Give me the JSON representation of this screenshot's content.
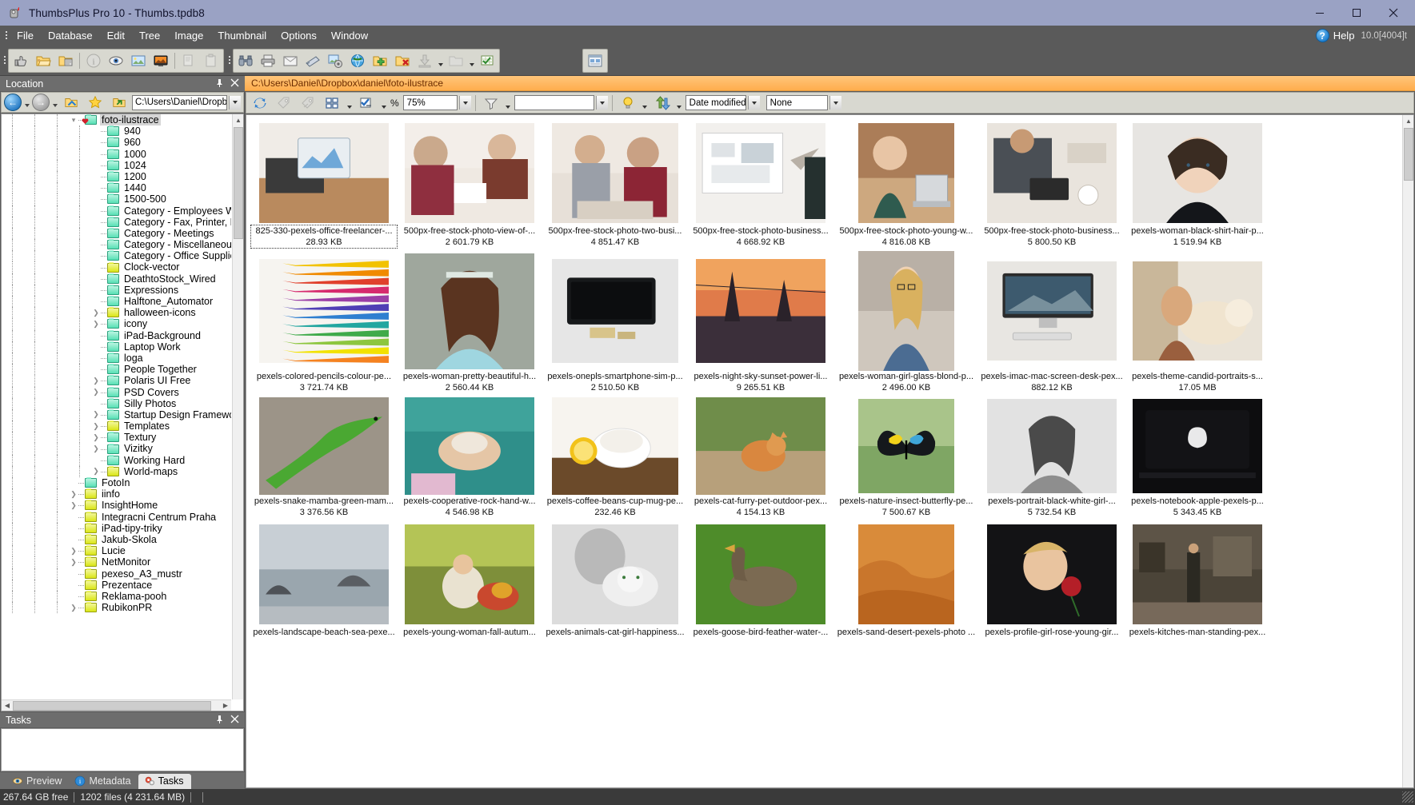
{
  "window": {
    "title": "ThumbsPlus Pro 10 - Thumbs.tpdb8",
    "app_icon": "thumbsplus-icon",
    "minimize": "–",
    "maximize": "□",
    "close": "✕"
  },
  "menubar": {
    "items": [
      "File",
      "Database",
      "Edit",
      "Tree",
      "Image",
      "Thumbnail",
      "Options",
      "Window"
    ],
    "help_label": "Help",
    "help_glyph": "?",
    "version": "10.0[4004]t"
  },
  "toolbar": {
    "group1": [
      "thumb-up-icon",
      "folder-open-icon",
      "folder-scan-icon",
      "info-icon",
      "eye-icon",
      "gallery-icon",
      "slideshow-icon",
      "copy-icon",
      "paste-icon"
    ],
    "group2": [
      "binoculars-icon",
      "print-icon",
      "email-icon",
      "scanner-icon",
      "batch-icon",
      "globe-icon",
      "folder-add-icon",
      "folder-delete-icon",
      "download-icon",
      "grid-check-icon"
    ],
    "group3": [
      "gallery-window-icon"
    ]
  },
  "location_panel": {
    "title": "Location",
    "pin": "📌",
    "close": "✕",
    "path_value": "C:\\Users\\Daniel\\Dropbox\\c",
    "nav_back": "back-arrow-icon",
    "nav_forward": "forward-arrow-icon",
    "buttons": [
      "folder-up-icon",
      "favorites-star-icon",
      "folder-go-icon"
    ]
  },
  "tree": {
    "items": [
      {
        "label": "foto-ilustrace",
        "depth": 4,
        "icon": "folder-teal-open",
        "twisty": "expanded",
        "selected": true,
        "favorite": true
      },
      {
        "label": "940",
        "depth": 5,
        "icon": "folder-teal",
        "twisty": "none"
      },
      {
        "label": "960",
        "depth": 5,
        "icon": "folder-teal",
        "twisty": "none"
      },
      {
        "label": "1000",
        "depth": 5,
        "icon": "folder-teal",
        "twisty": "none"
      },
      {
        "label": "1024",
        "depth": 5,
        "icon": "folder-teal",
        "twisty": "none"
      },
      {
        "label": "1200",
        "depth": 5,
        "icon": "folder-teal",
        "twisty": "none"
      },
      {
        "label": "1440",
        "depth": 5,
        "icon": "folder-teal",
        "twisty": "none"
      },
      {
        "label": "1500-500",
        "depth": 5,
        "icon": "folder-teal",
        "twisty": "none"
      },
      {
        "label": "Category - Employees Worki",
        "depth": 5,
        "icon": "folder-teal",
        "twisty": "none"
      },
      {
        "label": "Category - Fax, Printer, Phon",
        "depth": 5,
        "icon": "folder-teal",
        "twisty": "none"
      },
      {
        "label": "Category - Meetings",
        "depth": 5,
        "icon": "folder-teal",
        "twisty": "none"
      },
      {
        "label": "Category - Miscellaneous",
        "depth": 5,
        "icon": "folder-teal",
        "twisty": "none"
      },
      {
        "label": "Category - Office Supplies",
        "depth": 5,
        "icon": "folder-teal",
        "twisty": "none"
      },
      {
        "label": "Clock-vector",
        "depth": 5,
        "icon": "folder-yellow",
        "twisty": "none"
      },
      {
        "label": "DeathtoStock_Wired",
        "depth": 5,
        "icon": "folder-teal",
        "twisty": "none"
      },
      {
        "label": "Expressions",
        "depth": 5,
        "icon": "folder-teal",
        "twisty": "none"
      },
      {
        "label": "Halftone_Automator",
        "depth": 5,
        "icon": "folder-teal",
        "twisty": "none"
      },
      {
        "label": "halloween-icons",
        "depth": 5,
        "icon": "folder-yellow",
        "twisty": "collapsed"
      },
      {
        "label": "icony",
        "depth": 5,
        "icon": "folder-teal",
        "twisty": "collapsed"
      },
      {
        "label": "iPad-Background",
        "depth": 5,
        "icon": "folder-teal",
        "twisty": "none"
      },
      {
        "label": "Laptop Work",
        "depth": 5,
        "icon": "folder-teal",
        "twisty": "none"
      },
      {
        "label": "loga",
        "depth": 5,
        "icon": "folder-teal",
        "twisty": "none"
      },
      {
        "label": "People Together",
        "depth": 5,
        "icon": "folder-teal",
        "twisty": "none"
      },
      {
        "label": "Polaris UI Free",
        "depth": 5,
        "icon": "folder-teal",
        "twisty": "collapsed"
      },
      {
        "label": "PSD Covers",
        "depth": 5,
        "icon": "folder-teal",
        "twisty": "collapsed"
      },
      {
        "label": "Silly Photos",
        "depth": 5,
        "icon": "folder-teal",
        "twisty": "none"
      },
      {
        "label": "Startup Design Framework",
        "depth": 5,
        "icon": "folder-teal",
        "twisty": "collapsed"
      },
      {
        "label": "Templates",
        "depth": 5,
        "icon": "folder-yellow",
        "twisty": "collapsed"
      },
      {
        "label": "Textury",
        "depth": 5,
        "icon": "folder-teal",
        "twisty": "collapsed"
      },
      {
        "label": "Vizitky",
        "depth": 5,
        "icon": "folder-teal",
        "twisty": "collapsed"
      },
      {
        "label": "Working Hard",
        "depth": 5,
        "icon": "folder-teal",
        "twisty": "none"
      },
      {
        "label": "World-maps",
        "depth": 5,
        "icon": "folder-yellow",
        "twisty": "collapsed"
      },
      {
        "label": "FotoIn",
        "depth": 4,
        "icon": "folder-teal",
        "twisty": "none"
      },
      {
        "label": "iinfo",
        "depth": 4,
        "icon": "folder-yellow",
        "twisty": "collapsed"
      },
      {
        "label": "InsightHome",
        "depth": 4,
        "icon": "folder-yellow",
        "twisty": "collapsed"
      },
      {
        "label": "Integracni Centrum Praha",
        "depth": 4,
        "icon": "folder-yellow",
        "twisty": "none"
      },
      {
        "label": "iPad-tipy-triky",
        "depth": 4,
        "icon": "folder-yellow",
        "twisty": "none"
      },
      {
        "label": "Jakub-Skola",
        "depth": 4,
        "icon": "folder-yellow",
        "twisty": "none"
      },
      {
        "label": "Lucie",
        "depth": 4,
        "icon": "folder-yellow",
        "twisty": "collapsed"
      },
      {
        "label": "NetMonitor",
        "depth": 4,
        "icon": "folder-yellow",
        "twisty": "collapsed"
      },
      {
        "label": "pexeso_A3_mustr",
        "depth": 4,
        "icon": "folder-yellow",
        "twisty": "none"
      },
      {
        "label": "Prezentace",
        "depth": 4,
        "icon": "folder-yellow",
        "twisty": "none"
      },
      {
        "label": "Reklama-pooh",
        "depth": 4,
        "icon": "folder-yellow",
        "twisty": "none"
      },
      {
        "label": "RubikonPR",
        "depth": 4,
        "icon": "folder-yellow",
        "twisty": "collapsed"
      }
    ]
  },
  "tasks_panel": {
    "title": "Tasks",
    "pin": "📌",
    "close": "✕",
    "tabs": [
      {
        "label": "Preview",
        "icon": "eye-icon",
        "active": false
      },
      {
        "label": "Metadata",
        "icon": "info-icon",
        "active": false
      },
      {
        "label": "Tasks",
        "icon": "gears-icon",
        "active": true
      }
    ]
  },
  "view": {
    "path_bar": "C:\\Users\\Daniel\\Dropbox\\daniel\\foto-ilustrace",
    "refresh_icon": "refresh-icon",
    "tag_icon": "tag-icon",
    "tag_off_icon": "tag-off-icon",
    "layout_icon": "layout-icon",
    "select_icon": "select-check-icon",
    "percent_label": "%",
    "zoom_value": "75%",
    "filter_icon": "filter-icon",
    "filter_value": "",
    "bulb_icon": "lightbulb-icon",
    "sort_dir_icon": "sort-arrows-icon",
    "sort_field": "Date modified",
    "group_field": "None"
  },
  "thumbnails": {
    "rows": [
      [
        {
          "file": "825-330-pexels-office-freelancer-...",
          "size": "28.93 KB",
          "alt": "tablet-on-desk-with-laptop",
          "selected": true
        },
        {
          "file": "500px-free-stock-photo-view-of-...",
          "size": "2 601.79 KB",
          "alt": "people-at-table-planning"
        },
        {
          "file": "500px-free-stock-photo-two-busi...",
          "size": "4 851.47 KB",
          "alt": "two-business-people-meeting"
        },
        {
          "file": "500px-free-stock-photo-business...",
          "size": "4 668.92 KB",
          "alt": "business-presentation-whiteboard"
        },
        {
          "file": "500px-free-stock-photo-young-w...",
          "size": "4 816.08 KB",
          "alt": "young-woman-at-laptop"
        },
        {
          "file": "500px-free-stock-photo-business...",
          "size": "5 800.50 KB",
          "alt": "man-with-tablet-at-desk"
        },
        {
          "file": "pexels-woman-black-shirt-hair-p...",
          "size": "1 519.94 KB",
          "alt": "woman-portrait-black-shirt"
        }
      ],
      [
        {
          "file": "pexels-colored-pencils-colour-pe...",
          "size": "3 721.74 KB",
          "alt": "colored-pencils"
        },
        {
          "file": "pexels-woman-pretty-beautiful-h...",
          "size": "2 560.44 KB",
          "alt": "smiling-woman-portrait"
        },
        {
          "file": "pexels-onepls-smartphone-sim-p...",
          "size": "2 510.50 KB",
          "alt": "black-smartphone-on-table"
        },
        {
          "file": "pexels-night-sky-sunset-power-li...",
          "size": "9 265.51 KB",
          "alt": "power-lines-at-sunset"
        },
        {
          "file": "pexels-woman-girl-glass-blond-p...",
          "size": "2 496.00 KB",
          "alt": "blond-woman-with-glasses"
        },
        {
          "file": "pexels-imac-mac-screen-desk-pex...",
          "size": "882.12 KB",
          "alt": "imac-on-desk"
        },
        {
          "file": "pexels-theme-candid-portraits-s...",
          "size": "17.05 MB",
          "alt": "woman-with-dog-on-floor"
        }
      ],
      [
        {
          "file": "pexels-snake-mamba-green-mam...",
          "size": "3 376.56 KB",
          "alt": "green-mamba-snake"
        },
        {
          "file": "pexels-cooperative-rock-hand-w...",
          "size": "4 546.98 KB",
          "alt": "hands-holding-painted-stone"
        },
        {
          "file": "pexels-coffee-beans-cup-mug-pe...",
          "size": "232.46 KB",
          "alt": "coffee-cup-with-lemon"
        },
        {
          "file": "pexels-cat-furry-pet-outdoor-pex...",
          "size": "4 154.13 KB",
          "alt": "ginger-cat-outdoors"
        },
        {
          "file": "pexels-nature-insect-butterfly-pe...",
          "size": "7 500.67 KB",
          "alt": "butterfly-on-leaf"
        },
        {
          "file": "pexels-portrait-black-white-girl-...",
          "size": "5 732.54 KB",
          "alt": "black-and-white-girl-portrait"
        },
        {
          "file": "pexels-notebook-apple-pexels-p...",
          "size": "5 343.45 KB",
          "alt": "apple-logo-dark-laptop"
        }
      ],
      [
        {
          "file": "pexels-landscape-beach-sea-pexe...",
          "size": "",
          "alt": "beach-seascape-rocks"
        },
        {
          "file": "pexels-young-woman-fall-autum...",
          "size": "",
          "alt": "woman-sitting-in-autumn-leaves"
        },
        {
          "file": "pexels-animals-cat-girl-happiness...",
          "size": "",
          "alt": "girl-with-cat"
        },
        {
          "file": "pexels-goose-bird-feather-water-...",
          "size": "",
          "alt": "goose-on-grass"
        },
        {
          "file": "pexels-sand-desert-pexels-photo ...",
          "size": "",
          "alt": "sand-dunes"
        },
        {
          "file": "pexels-profile-girl-rose-young-gir...",
          "size": "",
          "alt": "boy-with-red-rose"
        },
        {
          "file": "pexels-kitches-man-standing-pex...",
          "size": "",
          "alt": "man-standing-in-kitchen"
        }
      ]
    ]
  },
  "statusbar": {
    "free_space": "267.64 GB free",
    "file_count": "1202 files (4 231.64 MB)"
  }
}
